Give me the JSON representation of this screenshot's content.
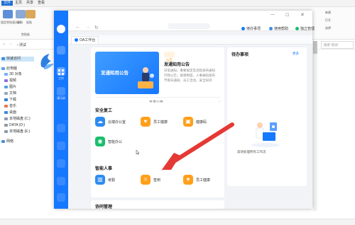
{
  "explorer": {
    "tabs": [
      {
        "label": "文件",
        "active": true
      },
      {
        "label": "主页",
        "active": false
      },
      {
        "label": "共享",
        "active": false
      },
      {
        "label": "查看",
        "active": false
      }
    ],
    "ribbon": {
      "pin": "固定到快速访问",
      "copy": "复制",
      "paste": "粘贴",
      "clipboard_group": "剪贴板",
      "right_items": [
        "新建",
        "打开",
        "选择"
      ]
    },
    "address": "› 测试",
    "search_placeholder": "搜索\"测试\"",
    "nav_items": [
      {
        "label": "快速访问",
        "selected": true
      },
      {
        "label": "此电脑",
        "selected": false
      },
      {
        "label": "3D 对象",
        "selected": false
      },
      {
        "label": "视频",
        "selected": false
      },
      {
        "label": "图片",
        "selected": false
      },
      {
        "label": "文档",
        "selected": false
      },
      {
        "label": "下载",
        "selected": false
      },
      {
        "label": "音乐",
        "selected": false
      },
      {
        "label": "桌面",
        "selected": false
      },
      {
        "label": "本地磁盘 (C:)",
        "selected": false
      },
      {
        "label": "DATA (D:)",
        "selected": false
      },
      {
        "label": "本地磁盘 (E:)",
        "selected": false
      },
      {
        "label": "网络",
        "selected": false
      }
    ],
    "side_app_icon": "bird-logo-icon"
  },
  "oa": {
    "sidebar": {
      "items": [
        {
          "label": "工作",
          "icon": "grid-icon"
        },
        {
          "label": "通讯录",
          "icon": "contacts-icon"
        }
      ]
    },
    "topbar": {
      "todo": "待办事项",
      "help": "使用帮助",
      "platform": "独立管理"
    },
    "tab": {
      "label": "OA工作台"
    },
    "announcement": {
      "banner_text": "发通知用公告",
      "badge": "公告",
      "title": "发通知用公告",
      "lines": [
        "日常通知，重要规定及流程发布通知",
        "行政公告，规章制度，人事通知发布",
        "节假日通知，员工活动，安全知识"
      ],
      "link": "去发公告"
    },
    "sections": [
      {
        "title": "安全复工",
        "apps": [
          {
            "name": "云端办公室",
            "color": "#2d8cf0",
            "glyph": "☁"
          },
          {
            "name": "员工健康",
            "color": "#ff9f1a",
            "glyph": "♥"
          },
          {
            "name": "健康码",
            "color": "#ff9f1a",
            "glyph": "▣"
          },
          {
            "name": "智能办公",
            "color": "#19be6b",
            "glyph": "◉"
          }
        ]
      },
      {
        "title": "智能人事",
        "apps": [
          {
            "name": "考勤",
            "color": "#2d8cf0",
            "glyph": "▥"
          },
          {
            "name": "签到",
            "color": "#ff9f1a",
            "glyph": "⌾"
          },
          {
            "name": "员工健康",
            "color": "#ff9f1a",
            "glyph": "♥"
          }
        ]
      },
      {
        "title": "协同管理",
        "apps": []
      }
    ],
    "todo_panel": {
      "title": "待办事项",
      "more": "更多",
      "empty_text": "高效处理所有工作流"
    }
  },
  "annotation": {
    "arrow_color": "#e53935"
  }
}
